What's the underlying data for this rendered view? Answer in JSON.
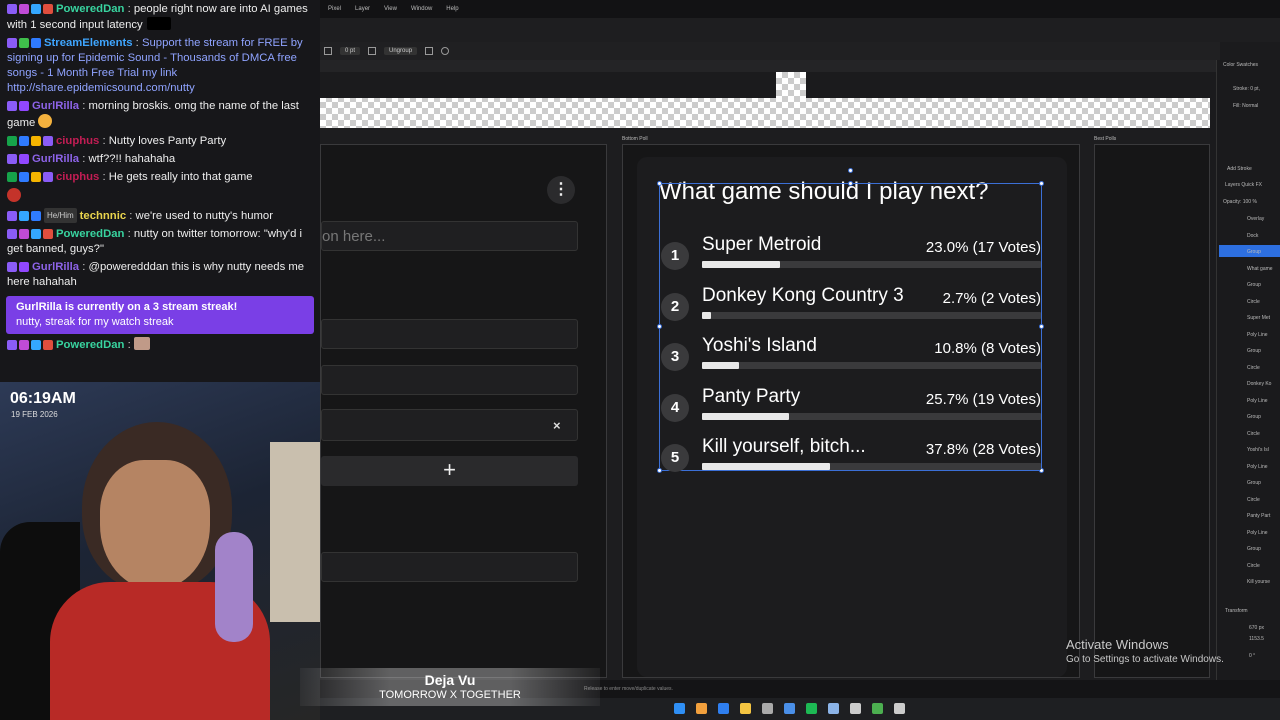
{
  "chat": {
    "messages": [
      {
        "user": "PoweredDan",
        "color": "#38d39f",
        "text": "people right now are into AI games with 1 second input latency",
        "badges": [
          "#8a5cf6",
          "#c04bd6",
          "#34a7ff",
          "#e04e3e"
        ]
      },
      {
        "user": "StreamElements",
        "color": "#3fa6ff",
        "text": "Support the stream for FREE by signing up for Epidemic Sound - Thousands of DMCA free songs - 1 Month Free Trial my link http://share.epidemicsound.com/nutty",
        "badges": [
          "#8a5cf6",
          "#3fbf4b",
          "#2f7bff"
        ]
      },
      {
        "user": "GurlRilla",
        "color": "#8d63e8",
        "text": "morning broskis. omg the name of the last game",
        "badges": [
          "#8a5cf6",
          "#9147ff"
        ]
      },
      {
        "user": "ciuphus",
        "color": "#c31d54",
        "text": "Nutty loves Panty Party",
        "badges": [
          "#16a34a",
          "#2f7bff",
          "#f5b400",
          "#8a5cf6"
        ]
      },
      {
        "user": "GurlRilla",
        "color": "#8d63e8",
        "text": "wtf??!! hahahaha",
        "badges": [
          "#8a5cf6",
          "#9147ff"
        ]
      },
      {
        "user": "ciuphus",
        "color": "#c31d54",
        "text": "He gets really into that game",
        "badges": [
          "#16a34a",
          "#2f7bff",
          "#f5b400",
          "#8a5cf6"
        ]
      },
      {
        "user": "technnic",
        "color": "#e8d44d",
        "text": "we're used to nutty's humor",
        "pronoun": "He/Him",
        "badges": [
          "#8a5cf6",
          "#34a7ff",
          "#2f7bff"
        ]
      },
      {
        "user": "PoweredDan",
        "color": "#38d39f",
        "text": "nutty on twitter tomorrow: \"why'd i get banned, guys?\"",
        "badges": [
          "#8a5cf6",
          "#c04bd6",
          "#34a7ff",
          "#e04e3e"
        ]
      },
      {
        "user": "GurlRilla",
        "color": "#8d63e8",
        "text": "@poweredddan this is why nutty needs me here hahahah",
        "badges": [
          "#8a5cf6",
          "#9147ff"
        ]
      },
      {
        "user": "PoweredDan",
        "color": "#38d39f",
        "text": "",
        "badges": [
          "#8a5cf6",
          "#c04bd6",
          "#34a7ff",
          "#e04e3e"
        ]
      }
    ],
    "streak_title": "GurlRilla is currently on a 3 stream streak!",
    "streak_msg": "nutty, streak for my watch streak",
    "separator": " : "
  },
  "webcam": {
    "time": "06:19AM",
    "date": "19 FEB 2026"
  },
  "editor": {
    "menu": [
      "Pixel",
      "Layer",
      "View",
      "Window",
      "Help"
    ],
    "toolbar": {
      "stroke_value": "0 pt",
      "ungroup_label": "Ungroup"
    },
    "artboard_labels": [
      "Bottom Poll",
      "Best Polls"
    ],
    "form": {
      "question_placeholder": "on here...",
      "close_label": "×",
      "add_label": "+",
      "menu_label": "⋮"
    },
    "poll": {
      "title": "What game should I play next?",
      "options": [
        {
          "num": "1",
          "name": "Super Metroid",
          "pct": "23.0% (17 Votes)",
          "share": 0.23
        },
        {
          "num": "2",
          "name": "Donkey Kong Country 3",
          "pct": "2.7% (2 Votes)",
          "share": 0.027
        },
        {
          "num": "3",
          "name": "Yoshi's Island",
          "pct": "10.8% (8 Votes)",
          "share": 0.108
        },
        {
          "num": "4",
          "name": "Panty Party",
          "pct": "25.7% (19 Votes)",
          "share": 0.257
        },
        {
          "num": "5",
          "name": "Kill yourself, bitch...",
          "pct": "37.8% (28 Votes)",
          "share": 0.378
        }
      ]
    },
    "right_panel": {
      "tabs": "Color   Swatches",
      "stroke": "Stroke: 0 pt,",
      "fill": "Fill: Normal",
      "add_stroke": "Add Stroke",
      "layers_tabs": "Layers   Quick FX",
      "opacity": "Opacity:  100 %",
      "layers": [
        "Overlay",
        "Dock",
        "Group",
        "What game",
        "Group",
        "Circle",
        "Super Met",
        "Poly Line",
        "Group",
        "Circle",
        "Donkey Ko",
        "Poly Line",
        "Group",
        "Circle",
        "Yoshi's Isl",
        "Poly Line",
        "Group",
        "Circle",
        "Panty Part",
        "Poly Line",
        "Group",
        "Circle",
        "Kill yourse"
      ],
      "transform": "Transform",
      "coords": [
        "670 px",
        "1153.5",
        "0 °"
      ]
    },
    "status_hint": "Release to enter move/duplicate values."
  },
  "windows_notice": {
    "line1": "Activate Windows",
    "line2": "Go to Settings to activate Windows."
  },
  "now_playing": {
    "song": "Deja Vu",
    "artist": "TOMORROW X TOGETHER"
  },
  "taskbar": {
    "icon_colors": [
      "#2f8ff5",
      "#f2a03d",
      "#2f7ff0",
      "#f5c542",
      "#aaaaaa",
      "#4a8fe8",
      "#1db954",
      "#8cb4e8",
      "#cccccc",
      "#4caf50",
      "#cccccc"
    ]
  }
}
